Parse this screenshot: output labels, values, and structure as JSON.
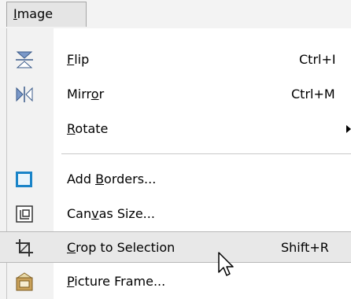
{
  "menubar": {
    "title_prefix": "",
    "title_u": "I",
    "title_rest": "mage"
  },
  "menu": {
    "flip": {
      "u": "F",
      "rest": "lip",
      "shortcut": "Ctrl+I",
      "icon": "flip-icon"
    },
    "mirror": {
      "pre": "Mirr",
      "u": "o",
      "rest": "r",
      "shortcut": "Ctrl+M",
      "icon": "mirror-icon"
    },
    "rotate": {
      "u": "R",
      "rest": "otate",
      "icon": "submenu-arrow-icon"
    },
    "add_borders": {
      "pre": "Add ",
      "u": "B",
      "rest": "orders...",
      "icon": "add-borders-icon"
    },
    "canvas_size": {
      "pre": "Can",
      "u": "v",
      "rest": "as Size...",
      "icon": "canvas-size-icon"
    },
    "crop": {
      "u": "C",
      "rest": "rop to Selection",
      "shortcut": "Shift+R",
      "icon": "crop-icon"
    },
    "picture_frame": {
      "u": "P",
      "rest": "icture Frame...",
      "icon": "picture-frame-icon"
    }
  },
  "colors": {
    "highlight": "#e8e8e8",
    "icon_blue": "#1a84c8",
    "frame_gold": "#c9a15a"
  }
}
